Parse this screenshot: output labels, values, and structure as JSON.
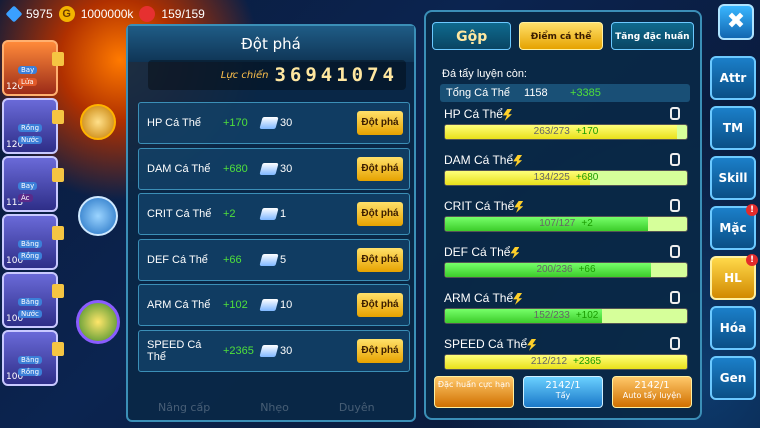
{
  "topbar": {
    "gems": "5975",
    "gold": "1000000k",
    "stamina": "159/159"
  },
  "left": {
    "cards": [
      {
        "level": "120",
        "tag1": "Bay",
        "tag2": "Lửa",
        "type": "fire"
      },
      {
        "level": "120",
        "tag1": "Rồng",
        "tag2": "Nước",
        "type": "blue"
      },
      {
        "level": "115",
        "tag1": "Bay",
        "tag2": "Ác",
        "type": "blue"
      },
      {
        "level": "100",
        "tag1": "Băng",
        "tag2": "Rồng",
        "type": "blue"
      },
      {
        "level": "100",
        "tag1": "Băng",
        "tag2": "Nước",
        "type": "blue"
      },
      {
        "level": "100",
        "tag1": "Băng",
        "tag2": "Rồng",
        "type": "blue"
      }
    ]
  },
  "panel": {
    "title": "Đột phá",
    "power_label": "Lực chiến",
    "power_value": "36941074",
    "rows": [
      {
        "label": "HP Cá Thể",
        "value": "+170",
        "count": "30",
        "btn": "Đột phá"
      },
      {
        "label": "DAM Cá Thể",
        "value": "+680",
        "count": "30",
        "btn": "Đột phá"
      },
      {
        "label": "CRIT Cá Thể",
        "value": "+2",
        "count": "1",
        "btn": "Đột phá"
      },
      {
        "label": "DEF Cá Thể",
        "value": "+66",
        "count": "5",
        "btn": "Đột phá"
      },
      {
        "label": "ARM Cá Thể",
        "value": "+102",
        "count": "10",
        "btn": "Đột phá"
      },
      {
        "label": "SPEED Cá Thể",
        "value": "+2365",
        "count": "30",
        "btn": "Đột phá"
      }
    ],
    "footer": [
      "Nâng cấp",
      "Nhẹo",
      "Duyên"
    ]
  },
  "right": {
    "tabs": [
      "Gộp",
      "Điểm cá thể",
      "Tăng đặc huấn"
    ],
    "subtitle": "Đá tẩy luyện còn:",
    "total_label": "Tổng Cá Thể",
    "total_value": "1158",
    "total_plus": "+3385",
    "stats": [
      {
        "label": "HP Cá Thể",
        "value": "263/273",
        "plus": "+170",
        "fill": 0.96,
        "green": false
      },
      {
        "label": "DAM Cá Thể",
        "value": "134/225",
        "plus": "+680",
        "fill": 0.6,
        "green": false
      },
      {
        "label": "CRIT Cá Thể",
        "value": "107/127",
        "plus": "+2",
        "fill": 0.84,
        "green": true
      },
      {
        "label": "DEF Cá Thể",
        "value": "200/236",
        "plus": "+66",
        "fill": 0.85,
        "green": true
      },
      {
        "label": "ARM Cá Thể",
        "value": "152/233",
        "plus": "+102",
        "fill": 0.65,
        "green": true
      },
      {
        "label": "SPEED Cá Thể",
        "value": "212/212",
        "plus": "+2365",
        "fill": 1.0,
        "green": false
      }
    ],
    "buttons": [
      {
        "label": "Đặc huấn cực hạn",
        "count": ""
      },
      {
        "label": "Tẩy",
        "count": "2142/1"
      },
      {
        "label": "Auto tẩy luyện",
        "count": "2142/1"
      }
    ]
  },
  "side": [
    "Attr",
    "TM",
    "Skill",
    "Mặc",
    "HL",
    "Hóa",
    "Gen"
  ],
  "close_label": "✖"
}
